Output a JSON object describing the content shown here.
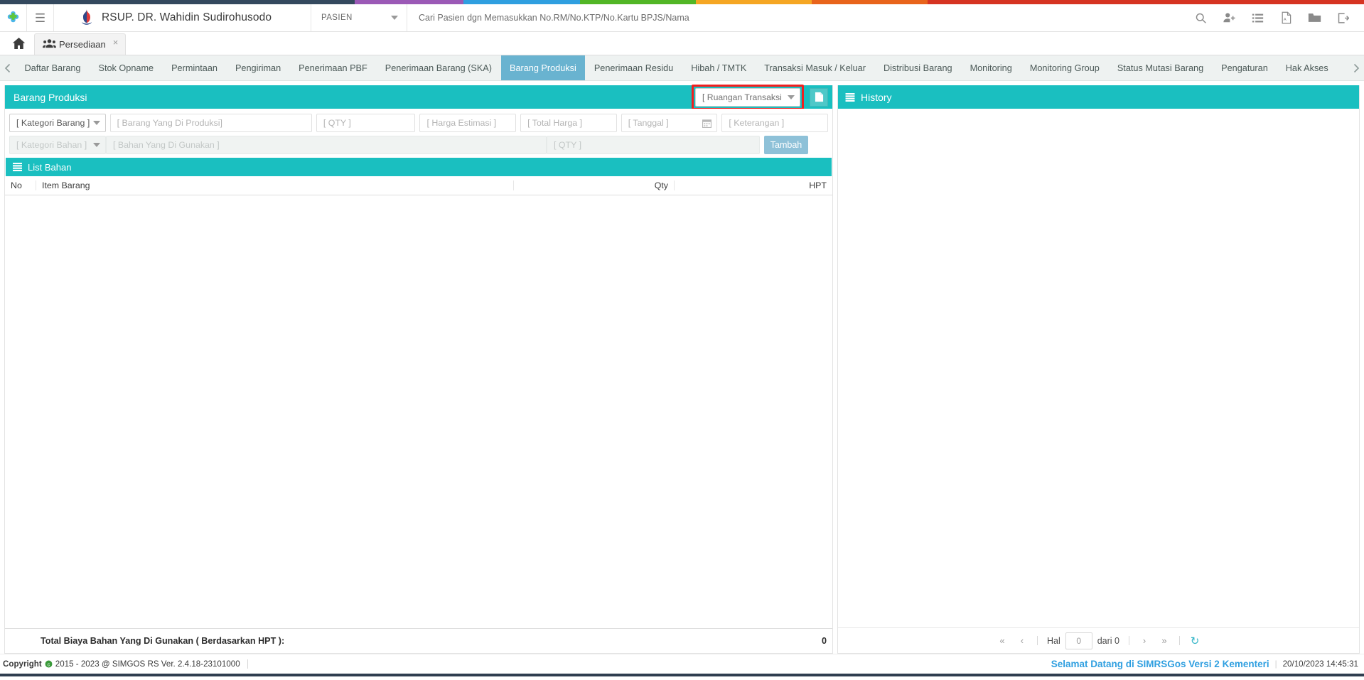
{
  "topstrip": {
    "segments": [
      {
        "color": "#34495e",
        "width": 26.0
      },
      {
        "color": "#9b59b6",
        "width": 8.0
      },
      {
        "color": "#2f9fe0",
        "width": 8.5
      },
      {
        "color": "#52b626",
        "width": 8.5
      },
      {
        "color": "#f5a623",
        "width": 8.5
      },
      {
        "color": "#e8641c",
        "width": 8.5
      },
      {
        "color": "#d63422",
        "width": 32.0
      }
    ]
  },
  "appbar": {
    "logo_icon": "simrs-logo-icon",
    "menu_icon": "hamburger-icon",
    "hospital_icon": "hospital-flame-icon",
    "hospital_name": "RSUP. DR. Wahidin Sudirohusodo",
    "module_select": "PASIEN",
    "search_placeholder": "Cari Pasien dgn Memasukkan No.RM/No.KTP/No.Kartu BPJS/Nama",
    "search_value": "",
    "icons": [
      {
        "name": "search-icon",
        "title": "Cari"
      },
      {
        "name": "add-user-icon",
        "title": "Tambah Pasien"
      },
      {
        "name": "list-icon",
        "title": "Daftar"
      },
      {
        "name": "pdf-icon",
        "title": "PDF"
      },
      {
        "name": "folder-icon",
        "title": "Berkas"
      },
      {
        "name": "logout-icon",
        "title": "Keluar"
      }
    ]
  },
  "tabstrip": {
    "home_icon": "home-icon",
    "tabs": [
      {
        "icon": "users-icon",
        "label": "Persediaan",
        "close": "×",
        "active": true
      }
    ]
  },
  "modnav": {
    "prev_icon": "chevron-left-icon",
    "next_icon": "chevron-right-icon",
    "items": [
      {
        "label": "Daftar Barang",
        "active": false
      },
      {
        "label": "Stok Opname",
        "active": false
      },
      {
        "label": "Permintaan",
        "active": false
      },
      {
        "label": "Pengiriman",
        "active": false
      },
      {
        "label": "Penerimaan PBF",
        "active": false
      },
      {
        "label": "Penerimaan Barang (SKA)",
        "active": false
      },
      {
        "label": "Barang Produksi",
        "active": true
      },
      {
        "label": "Penerimaan Residu",
        "active": false
      },
      {
        "label": "Hibah / TMTK",
        "active": false
      },
      {
        "label": "Transaksi Masuk / Keluar",
        "active": false
      },
      {
        "label": "Distribusi Barang",
        "active": false
      },
      {
        "label": "Monitoring",
        "active": false
      },
      {
        "label": "Monitoring Group",
        "active": false
      },
      {
        "label": "Status Mutasi Barang",
        "active": false
      },
      {
        "label": "Pengaturan",
        "active": false
      },
      {
        "label": "Hak Akses",
        "active": false
      }
    ]
  },
  "panel": {
    "title": "Barang Produksi",
    "ruangan_select": "[ Ruangan Transaksi",
    "ruangan_highlight_color": "#f01f1f",
    "new_doc_icon": "document-icon",
    "accent_color": "#1abfc0"
  },
  "form": {
    "row1": [
      {
        "name": "kategori-barang-select",
        "placeholder": "[ Kategori Barang ]",
        "value": "[ Kategori Barang ]",
        "type": "select",
        "width": "w-kat"
      },
      {
        "name": "barang-produksi-input",
        "placeholder": "[ Barang Yang Di Produksi]",
        "value": "",
        "type": "text",
        "width": "w-brg"
      },
      {
        "name": "qty-input",
        "placeholder": "[ QTY ]",
        "value": "",
        "type": "text",
        "width": "w-qty"
      },
      {
        "name": "harga-estimasi-input",
        "placeholder": "[ Harga Estimasi ]",
        "value": "",
        "type": "text",
        "width": "w-har"
      },
      {
        "name": "total-harga-input",
        "placeholder": "[ Total Harga ]",
        "value": "",
        "type": "text",
        "width": "w-tot"
      },
      {
        "name": "tanggal-input",
        "placeholder": "[ Tanggal ]",
        "value": "",
        "type": "date",
        "width": "w-tgl"
      },
      {
        "name": "keterangan-input",
        "placeholder": "[ Keterangan ]",
        "value": "",
        "type": "text",
        "width": "w-ket"
      }
    ],
    "row2": [
      {
        "name": "kategori-bahan-select",
        "placeholder": "[ Kategori Bahan ]",
        "value": "[ Kategori Bahan ]",
        "type": "select",
        "width": "w-katb",
        "disabled": true
      },
      {
        "name": "bahan-digunakan-input",
        "placeholder": "[ Bahan Yang Di Gunakan ]",
        "value": "",
        "type": "text",
        "width": "w-bahan",
        "disabled": true
      },
      {
        "name": "qty-bahan-input",
        "placeholder": "[ QTY ]",
        "value": "",
        "type": "text",
        "width": "w-qtyb",
        "disabled": true
      }
    ],
    "tambah_label": "Tambah"
  },
  "listbahan": {
    "icon": "list-icon",
    "title": "List Bahan",
    "columns": [
      "No",
      "Item Barang",
      "Qty",
      "HPT"
    ],
    "rows": [],
    "total_label": "Total Biaya Bahan Yang Di Gunakan ( Berdasarkan HPT ):",
    "total_value": "0"
  },
  "history": {
    "icon": "list-icon",
    "title": "History",
    "rows": [],
    "pager": {
      "first_icon": "chevron-double-left-icon",
      "prev_icon": "chevron-left-icon",
      "page_label": "Hal",
      "page_value": "0",
      "of_label": "dari 0",
      "next_icon": "chevron-right-icon",
      "last_icon": "chevron-double-right-icon",
      "refresh_icon": "refresh-icon"
    }
  },
  "footer": {
    "copyright_bold": "Copyright",
    "copyright_text": "2015 - 2023 @ SIMGOS RS Ver. 2.4.18-23101000",
    "welcome": "Selamat Datang di SIMRSGos Versi 2 Kementeri",
    "datetime": "20/10/2023 14:45:31"
  }
}
